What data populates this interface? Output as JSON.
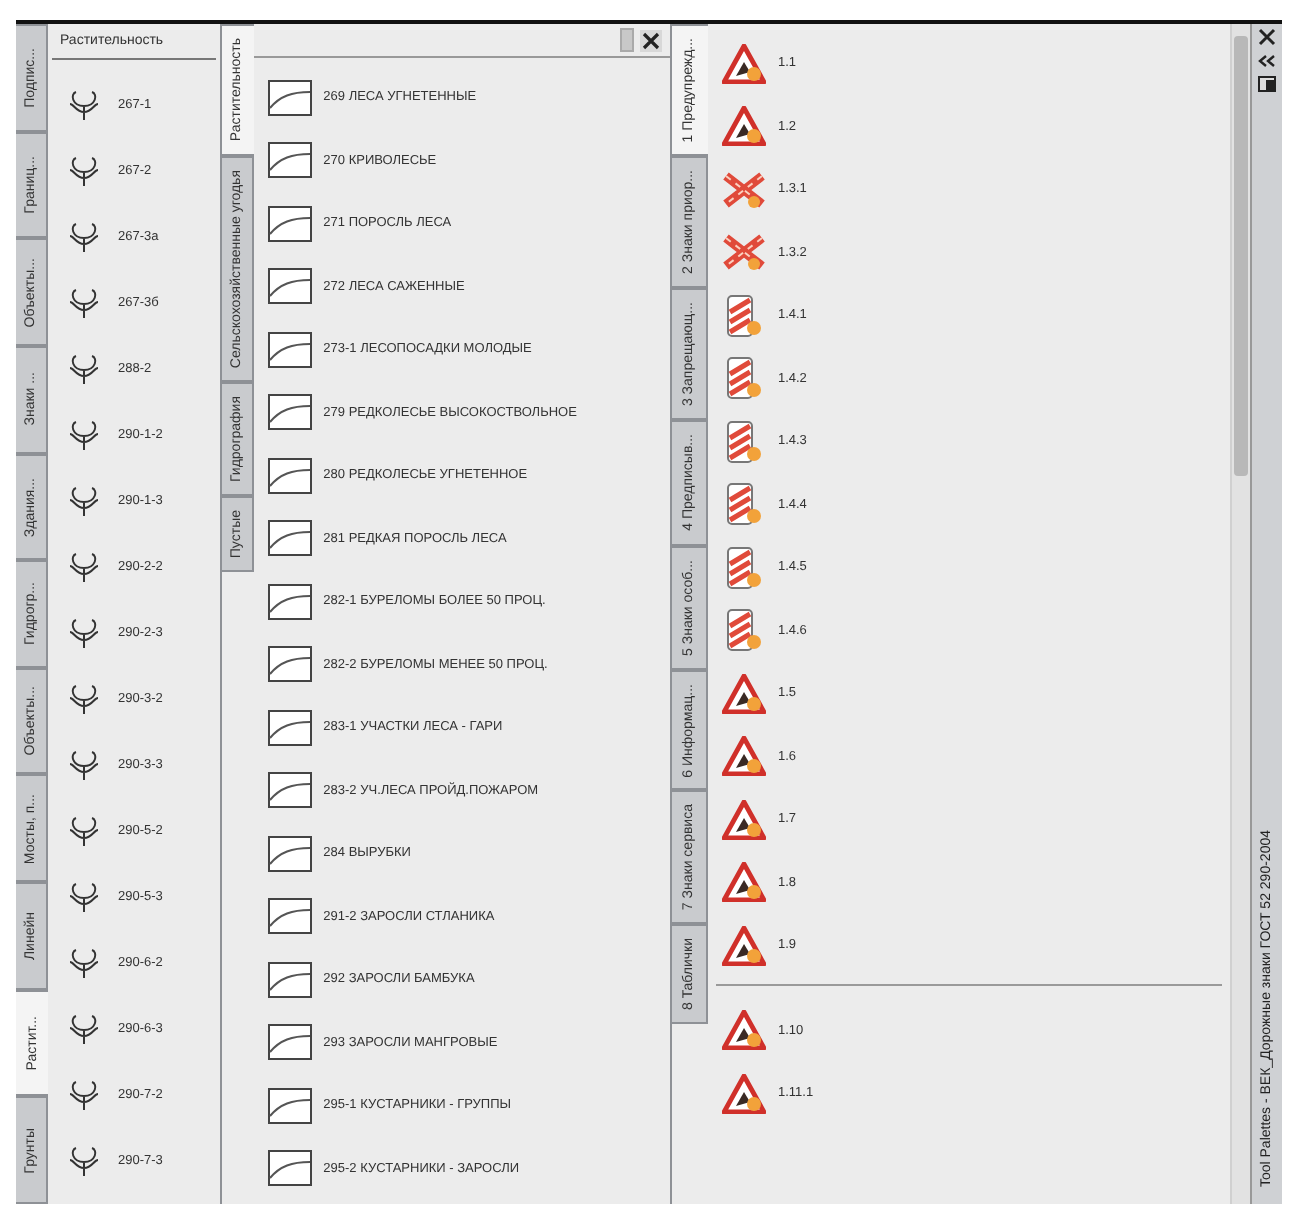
{
  "left_palette": {
    "title": "Растительность",
    "tabs": [
      {
        "label": "Подпис...",
        "selected": false
      },
      {
        "label": "Границ...",
        "selected": false
      },
      {
        "label": "Объекты...",
        "selected": false
      },
      {
        "label": "Знаки ...",
        "selected": false
      },
      {
        "label": "Здания...",
        "selected": false
      },
      {
        "label": "Гидрогр...",
        "selected": false
      },
      {
        "label": "Объекты...",
        "selected": false
      },
      {
        "label": "Мосты, п...",
        "selected": false
      },
      {
        "label": "Линейн",
        "selected": false
      },
      {
        "label": "Растит...",
        "selected": true
      },
      {
        "label": "Грунты",
        "selected": false
      }
    ],
    "items": [
      {
        "label": "267-1"
      },
      {
        "label": "267-2"
      },
      {
        "label": "267-3а"
      },
      {
        "label": "267-3б"
      },
      {
        "label": "288-2"
      },
      {
        "label": "290-1-2"
      },
      {
        "label": "290-1-3"
      },
      {
        "label": "290-2-2"
      },
      {
        "label": "290-2-3"
      },
      {
        "label": "290-3-2"
      },
      {
        "label": "290-3-3"
      },
      {
        "label": "290-5-2"
      },
      {
        "label": "290-5-3"
      },
      {
        "label": "290-6-2"
      },
      {
        "label": "290-6-3"
      },
      {
        "label": "290-7-2"
      },
      {
        "label": "290-7-3"
      }
    ]
  },
  "middle_palette": {
    "tabs": [
      {
        "label": "Растительность",
        "selected": true
      },
      {
        "label": "Сельскохозяйственные угодья",
        "selected": false
      },
      {
        "label": "Гидрография",
        "selected": false
      },
      {
        "label": "Пустые",
        "selected": false
      }
    ],
    "items": [
      {
        "label": "269 ЛЕСА УГНЕТЕННЫЕ"
      },
      {
        "label": "270 КРИВОЛЕСЬЕ"
      },
      {
        "label": "271 ПОРОСЛЬ ЛЕСА"
      },
      {
        "label": "272 ЛЕСА САЖЕННЫЕ"
      },
      {
        "label": "273-1 ЛЕСОПОСАДКИ МОЛОДЫЕ"
      },
      {
        "label": "279 РЕДКОЛЕСЬЕ ВЫСОКОСТВОЛЬНОЕ"
      },
      {
        "label": "280 РЕДКОЛЕСЬЕ УГНЕТЕННОЕ"
      },
      {
        "label": "281 РЕДКАЯ ПОРОСЛЬ ЛЕСА"
      },
      {
        "label": "282-1 БУРЕЛОМЫ БОЛЕЕ 50 ПРОЦ."
      },
      {
        "label": "282-2 БУРЕЛОМЫ МЕНЕЕ 50 ПРОЦ."
      },
      {
        "label": "283-1 УЧАСТКИ ЛЕСА - ГАРИ"
      },
      {
        "label": "283-2 УЧ.ЛЕСА ПРОЙД.ПОЖАРОМ"
      },
      {
        "label": "284 ВЫРУБКИ"
      },
      {
        "label": "291-2 ЗАРОСЛИ СТЛАНИКА"
      },
      {
        "label": "292 ЗАРОСЛИ БАМБУКА"
      },
      {
        "label": "293 ЗАРОСЛИ МАНГРОВЫЕ"
      },
      {
        "label": "295-1 КУСТАРНИКИ - ГРУППЫ"
      },
      {
        "label": "295-2 КУСТАРНИКИ - ЗАРОСЛИ"
      }
    ]
  },
  "right_palette": {
    "title": "Tool Palettes - ВЕК_Дорожные знаки ГОСТ 52 290-2004",
    "tabs": [
      {
        "label": "1 Предупрежд...",
        "selected": true
      },
      {
        "label": "2 Знаки приор...",
        "selected": false
      },
      {
        "label": "3 Запрещающ...",
        "selected": false
      },
      {
        "label": "4 Предписыв...",
        "selected": false
      },
      {
        "label": "5 Знаки особ...",
        "selected": false
      },
      {
        "label": "6 Информац...",
        "selected": false
      },
      {
        "label": "7 Знаки сервиса",
        "selected": false
      },
      {
        "label": "8 Таблички",
        "selected": false
      }
    ],
    "groups": [
      [
        {
          "label": "1.1",
          "kind": "triangle"
        },
        {
          "label": "1.2",
          "kind": "triangle"
        },
        {
          "label": "1.3.1",
          "kind": "cross"
        },
        {
          "label": "1.3.2",
          "kind": "cross"
        },
        {
          "label": "1.4.1",
          "kind": "stripes"
        },
        {
          "label": "1.4.2",
          "kind": "stripes"
        },
        {
          "label": "1.4.3",
          "kind": "stripes"
        },
        {
          "label": "1.4.4",
          "kind": "stripes"
        },
        {
          "label": "1.4.5",
          "kind": "stripes"
        },
        {
          "label": "1.4.6",
          "kind": "stripes"
        },
        {
          "label": "1.5",
          "kind": "triangle"
        },
        {
          "label": "1.6",
          "kind": "triangle"
        },
        {
          "label": "1.7",
          "kind": "triangle"
        },
        {
          "label": "1.8",
          "kind": "triangle"
        },
        {
          "label": "1.9",
          "kind": "triangle"
        }
      ],
      [
        {
          "label": "1.10",
          "kind": "triangle"
        },
        {
          "label": "1.11.1",
          "kind": "triangle"
        }
      ]
    ]
  }
}
